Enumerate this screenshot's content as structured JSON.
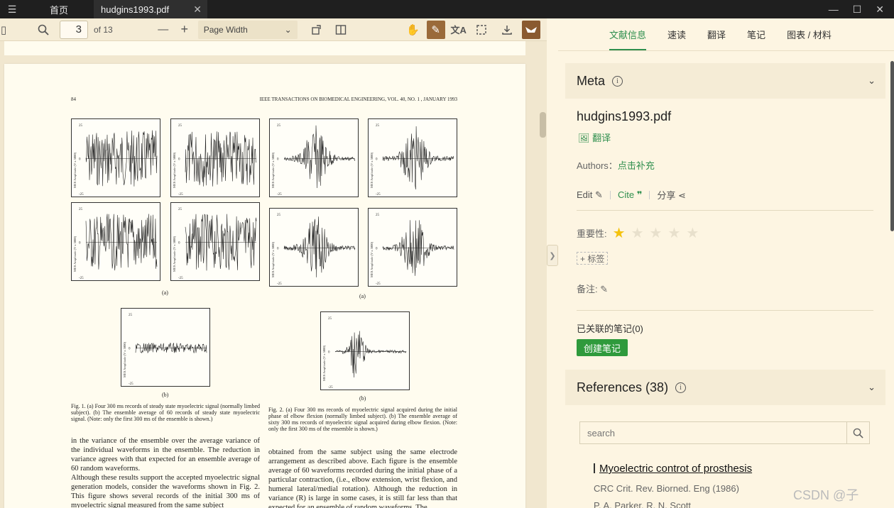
{
  "titlebar": {
    "home_tab": "首页",
    "doc_tab": "hudgins1993.pdf",
    "close": "✕"
  },
  "toolbar": {
    "page_current": "3",
    "page_total": "of 13",
    "zoom": "Page Width",
    "minus": "—",
    "plus": "+"
  },
  "document": {
    "page_number": "84",
    "journal_header": "IEEE TRANSACTIONS ON BIOMEDICAL ENGINEERING, VOL. 40, NO. 1 , JANUARY 1993",
    "ylabel_ticks": [
      "25",
      "0",
      "-25"
    ],
    "ylabel": "MES Amplitude (V x 5000)",
    "label_a": "(a)",
    "label_b": "(b)",
    "fig1_caption": "Fig. 1. (a) Four 300 ms records of steady state myoelectric signal (normally limbed subject). (b) The ensemble average of 60 records of steady state myoelectric signal. (Note: only the first 300 ms of the ensemble is shown.)",
    "fig2_caption": "Fig. 2. (a) Four 300 ms records of myoelectric signal acquired during the initial phase of elbow flexion (normally limbed subject). (b) The ensemble average of sixty 300 ms records of myoelectric signal acquired during elbow flexion. (Note: only the first 300 ms of the ensemble is shown.)",
    "left_text": "in the variance of the ensemble over the average variance of the individual waveforms in the ensemble. The reduction in variance agrees with that expected for an ensemble average of 60 random waveforms.\n    Although these results support the accepted myoelectric signal generation models, consider the waveforms shown in Fig. 2. This figure shows several records of the initial 300 ms of myoelectric signal measured from the same subject",
    "right_text": "obtained from the same subject using the same electrode arrangement as described above. Each figure is the ensemble average of 60 waveforms recorded during the initial phase of a particular contraction, (i.e., elbow extension, wrist flexion, and humeral lateral/medial rotation). Although the reduction in variance (R) is large in some cases, it is still far less than that expected for an ensemble of random waveforms. The"
  },
  "panel": {
    "tabs": [
      "文献信息",
      "速读",
      "翻译",
      "笔记",
      "图表 / 材料"
    ],
    "meta_title": "Meta",
    "file_name": "hudgins1993.pdf",
    "translate": "翻译",
    "authors_label": "Authors：",
    "authors_link": "点击补充",
    "edit": "Edit",
    "cite": "Cite",
    "share": "分享",
    "importance_label": "重要性:",
    "importance_rating": 1,
    "tag_label": "+ 标签",
    "note_label": "备注:",
    "linked_notes": "已关联的笔记(0)",
    "create_note": "创建笔记",
    "references_title": "References (38)",
    "search_placeholder": "search",
    "ref_title": "Myoelectric controt of prosthesis",
    "ref_journal": "CRC Crit. Rev. Biorned. Eng (1986)",
    "ref_authors": "P. A. Parker, R. N. Scott"
  },
  "watermark": "CSDN @子"
}
